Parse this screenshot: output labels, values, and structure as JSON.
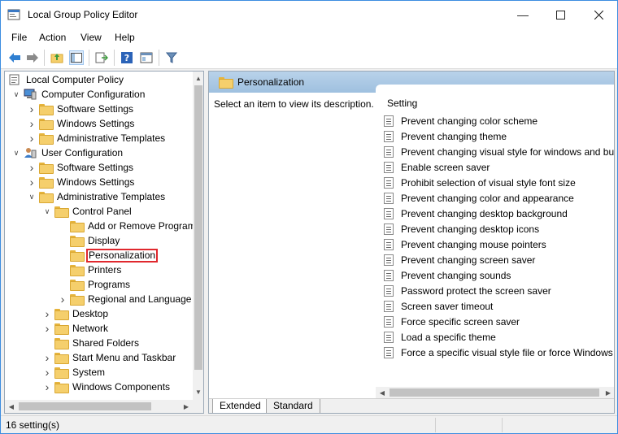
{
  "window": {
    "title": "Local Group Policy Editor"
  },
  "menu": [
    "File",
    "Action",
    "View",
    "Help"
  ],
  "toolbar_icons": [
    "back-arrow-icon",
    "forward-arrow-icon",
    "up-folder-icon",
    "show-hide-tree-icon",
    "export-list-icon",
    "help-icon",
    "properties-icon",
    "filter-icon"
  ],
  "tree": {
    "items": [
      {
        "label": "Local Computer Policy",
        "level": 0,
        "expander": "none",
        "icon": "policy-document-icon"
      },
      {
        "label": "Computer Configuration",
        "level": 1,
        "expander": "expanded",
        "icon": "computer-icon"
      },
      {
        "label": "Software Settings",
        "level": 2,
        "expander": "collapsed",
        "icon": "folder-icon"
      },
      {
        "label": "Windows Settings",
        "level": 2,
        "expander": "collapsed",
        "icon": "folder-icon"
      },
      {
        "label": "Administrative Templates",
        "level": 2,
        "expander": "collapsed",
        "icon": "folder-icon"
      },
      {
        "label": "User Configuration",
        "level": 1,
        "expander": "expanded",
        "icon": "user-icon"
      },
      {
        "label": "Software Settings",
        "level": 2,
        "expander": "collapsed",
        "icon": "folder-icon"
      },
      {
        "label": "Windows Settings",
        "level": 2,
        "expander": "collapsed",
        "icon": "folder-icon"
      },
      {
        "label": "Administrative Templates",
        "level": 2,
        "expander": "expanded",
        "icon": "folder-icon"
      },
      {
        "label": "Control Panel",
        "level": 3,
        "expander": "expanded",
        "icon": "folder-icon"
      },
      {
        "label": "Add or Remove Programs",
        "level": 4,
        "expander": "none",
        "icon": "folder-icon"
      },
      {
        "label": "Display",
        "level": 4,
        "expander": "none",
        "icon": "folder-icon"
      },
      {
        "label": "Personalization",
        "level": 4,
        "expander": "none",
        "icon": "folder-icon",
        "selected": true
      },
      {
        "label": "Printers",
        "level": 4,
        "expander": "none",
        "icon": "folder-icon"
      },
      {
        "label": "Programs",
        "level": 4,
        "expander": "none",
        "icon": "folder-icon"
      },
      {
        "label": "Regional and Language",
        "level": 4,
        "expander": "collapsed",
        "icon": "folder-icon"
      },
      {
        "label": "Desktop",
        "level": 3,
        "expander": "collapsed",
        "icon": "folder-icon"
      },
      {
        "label": "Network",
        "level": 3,
        "expander": "collapsed",
        "icon": "folder-icon"
      },
      {
        "label": "Shared Folders",
        "level": 3,
        "expander": "none",
        "icon": "folder-icon"
      },
      {
        "label": "Start Menu and Taskbar",
        "level": 3,
        "expander": "collapsed",
        "icon": "folder-icon"
      },
      {
        "label": "System",
        "level": 3,
        "expander": "collapsed",
        "icon": "folder-icon"
      },
      {
        "label": "Windows Components",
        "level": 3,
        "expander": "collapsed",
        "icon": "folder-icon"
      }
    ]
  },
  "right": {
    "header": "Personalization",
    "description": "Select an item to view its description.",
    "column_header": "Setting",
    "settings": [
      "Prevent changing color scheme",
      "Prevent changing theme",
      "Prevent changing visual style for windows and buttons",
      "Enable screen saver",
      "Prohibit selection of visual style font size",
      "Prevent changing color and appearance",
      "Prevent changing desktop background",
      "Prevent changing desktop icons",
      "Prevent changing mouse pointers",
      "Prevent changing screen saver",
      "Prevent changing sounds",
      "Password protect the screen saver",
      "Screen saver timeout",
      "Force specific screen saver",
      "Load a specific theme",
      "Force a specific visual style file or force Windows Classic"
    ],
    "tabs": [
      "Extended",
      "Standard"
    ],
    "active_tab": "Extended"
  },
  "status": {
    "text": "16 setting(s)"
  }
}
